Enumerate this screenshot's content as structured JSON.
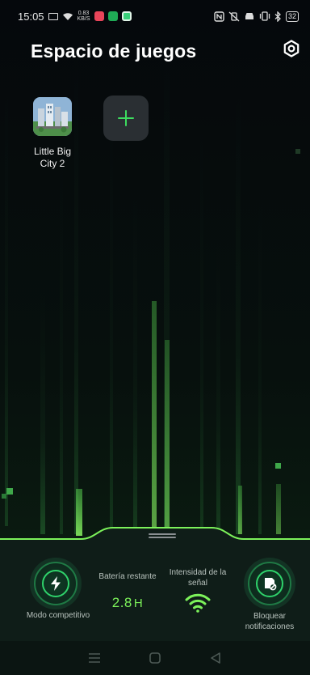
{
  "status_bar": {
    "time": "15:05",
    "speed_value": "0.83",
    "speed_unit": "KB/S",
    "battery": "32"
  },
  "header": {
    "title": "Espacio de juegos",
    "settings_icon": "gear-icon"
  },
  "games": [
    {
      "name": "Little Big City 2",
      "icon": "game-city-icon"
    }
  ],
  "add_button": {
    "icon": "plus-icon"
  },
  "panel": {
    "competitive_mode": {
      "label": "Modo competitivo",
      "icon": "lightning-icon"
    },
    "battery": {
      "label": "Batería restante",
      "value": "2.8",
      "unit": "H"
    },
    "signal": {
      "label": "Intensidad de la señal",
      "icon": "wifi-icon"
    },
    "block_notifications": {
      "label": "Bloquear notificaciones",
      "icon": "notification-block-icon"
    }
  },
  "nav_bar": {
    "menu_icon": "menu-icon",
    "home_icon": "home-icon",
    "back_icon": "back-icon"
  },
  "colors": {
    "accent": "#7cf25a",
    "ring": "#2fd36b",
    "panel_bg": "#0f1d18",
    "screen_bg": "#06090d"
  }
}
